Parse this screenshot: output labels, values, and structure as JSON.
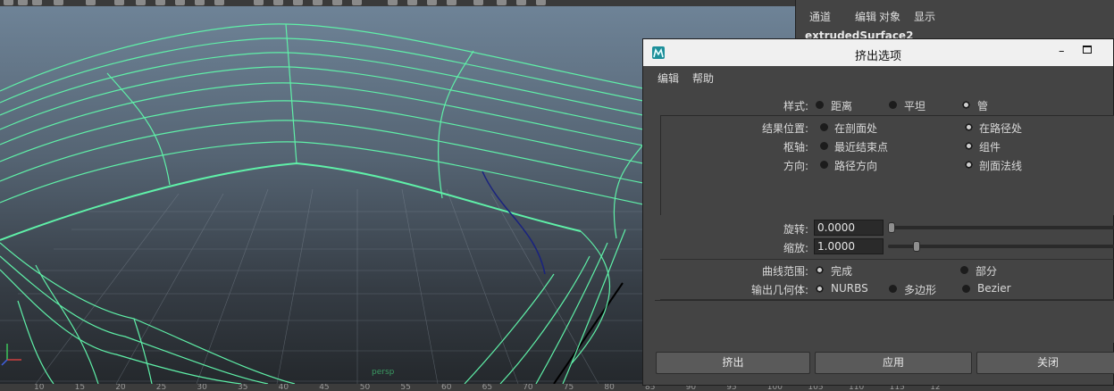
{
  "channel_box": {
    "menu": [
      "通道",
      "编辑",
      "对象",
      "显示"
    ],
    "object_name": "extrudedSurface2"
  },
  "dialog": {
    "title": "挤出选项",
    "minimize": "–",
    "menu": [
      "编辑",
      "帮助"
    ],
    "style": {
      "label": "样式:",
      "options": [
        "距离",
        "平坦",
        "管"
      ],
      "selected": "管"
    },
    "result_position": {
      "label": "结果位置:",
      "options": [
        "在剖面处",
        "在路径处"
      ],
      "selected": "在路径处"
    },
    "pivot": {
      "label": "枢轴:",
      "options": [
        "最近结束点",
        "组件"
      ],
      "selected": "组件"
    },
    "orientation": {
      "label": "方向:",
      "options": [
        "路径方向",
        "剖面法线"
      ],
      "selected": "剖面法线"
    },
    "rotation": {
      "label": "旋转:",
      "value": "0.0000",
      "slider_fraction": 0.0
    },
    "scale": {
      "label": "缩放:",
      "value": "1.0000",
      "slider_fraction": 0.11
    },
    "curve_range": {
      "label": "曲线范围:",
      "options": [
        "完成",
        "部分"
      ],
      "selected": "完成"
    },
    "output_geometry": {
      "label": "输出几何体:",
      "options": [
        "NURBS",
        "多边形",
        "Bezier"
      ],
      "selected": "NURBS"
    },
    "buttons": {
      "extrude": "挤出",
      "apply": "应用",
      "close": "关闭"
    }
  },
  "ruler": {
    "ticks": [
      "10",
      "15",
      "20",
      "25",
      "30",
      "35",
      "40",
      "45",
      "50",
      "55",
      "60",
      "65",
      "70",
      "75",
      "80",
      "85",
      "90",
      "95",
      "100",
      "105",
      "110",
      "115",
      "12"
    ]
  },
  "viewport": {
    "grid_label": "persp"
  },
  "colors": {
    "wire": "#5ff0a8",
    "curve": "#1a237e",
    "sky": "#6e8397",
    "ground": "#24282c"
  }
}
